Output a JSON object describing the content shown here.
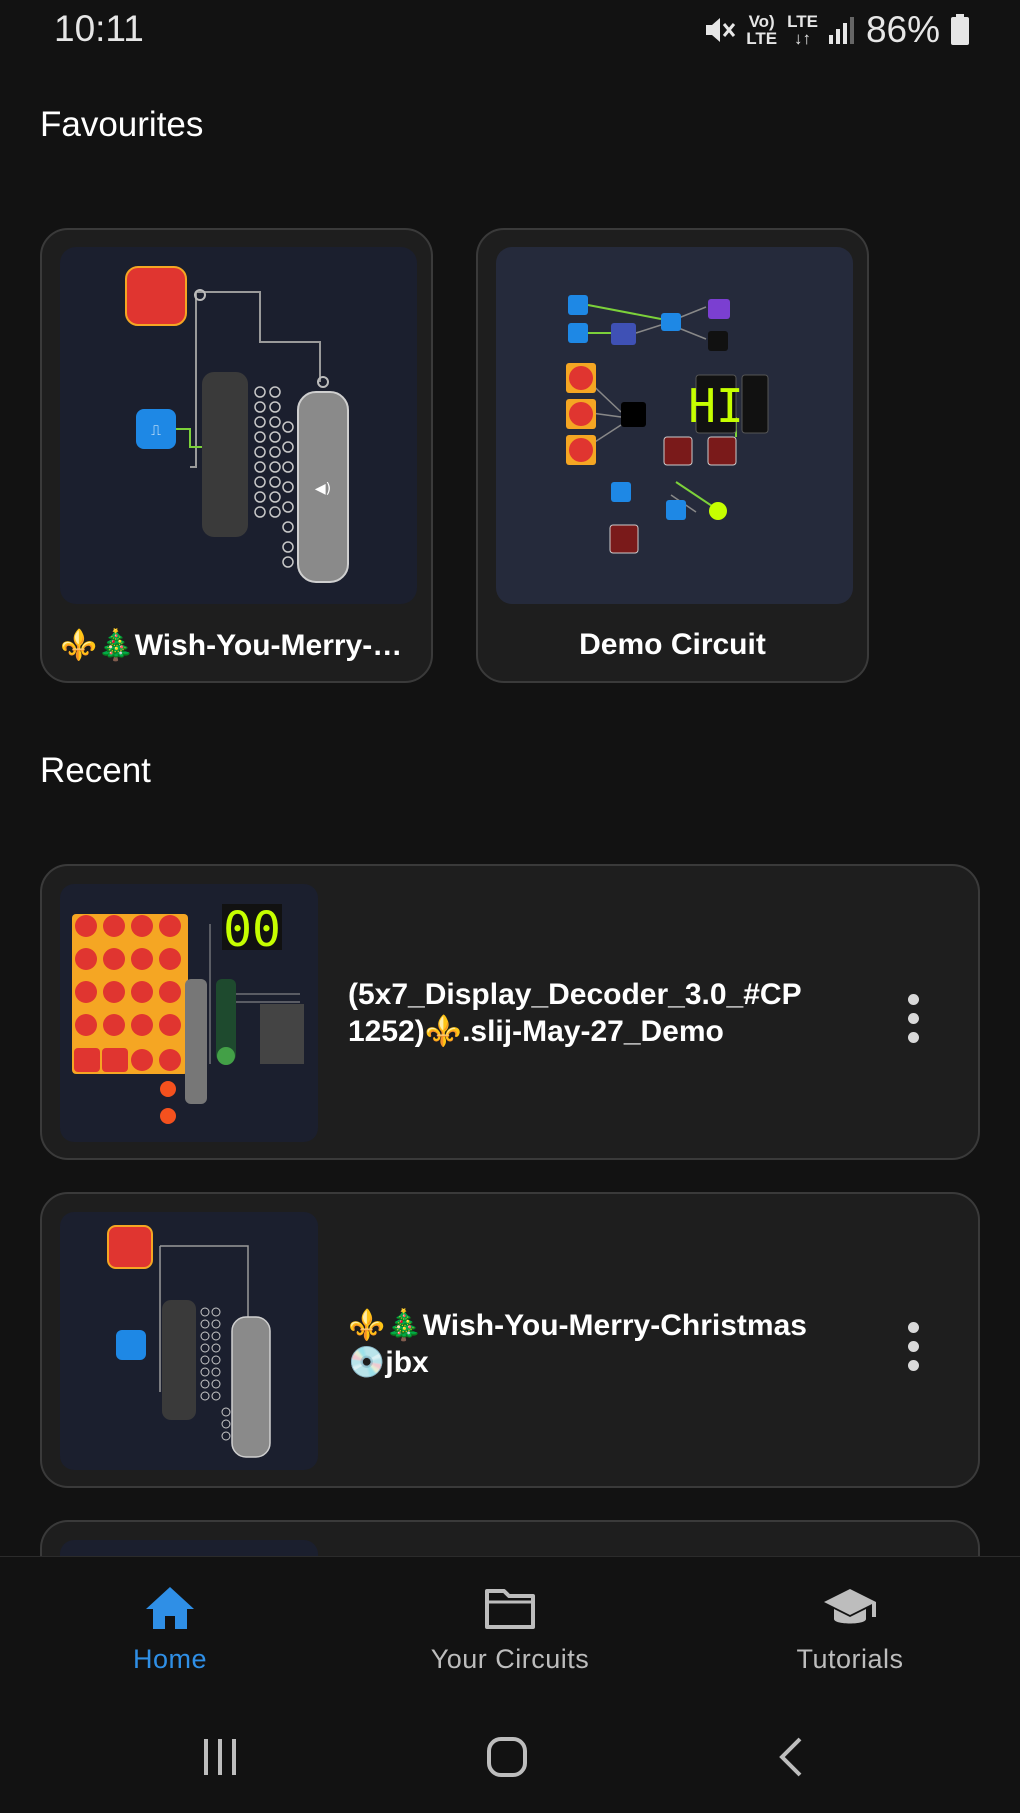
{
  "status_bar": {
    "time": "10:11",
    "battery": "86%",
    "volte_top": "Vo)",
    "volte_bottom": "LTE",
    "lte": "LTE"
  },
  "favourites": {
    "title": "Favourites",
    "items": [
      {
        "title": "⚜️🎄Wish-You-Merry-C..."
      },
      {
        "title": "Demo Circuit"
      }
    ]
  },
  "recent": {
    "title": "Recent",
    "items": [
      {
        "title": "(5x7_Display_Decoder_3.0_#CP1252)⚜️.slij-May-27_Demo",
        "seg_display": "00"
      },
      {
        "title": "⚜️🎄Wish-You-Merry-Christmas 💿jbx"
      }
    ]
  },
  "bottom_nav": {
    "active_color": "#2f8fe6",
    "inactive_color": "#bdbdbd",
    "items": [
      {
        "label": "Home",
        "icon": "home-icon"
      },
      {
        "label": "Your Circuits",
        "icon": "folder-icon"
      },
      {
        "label": "Tutorials",
        "icon": "graduation-cap-icon"
      }
    ]
  },
  "demo_circuit": {
    "seg_text": "HI"
  }
}
